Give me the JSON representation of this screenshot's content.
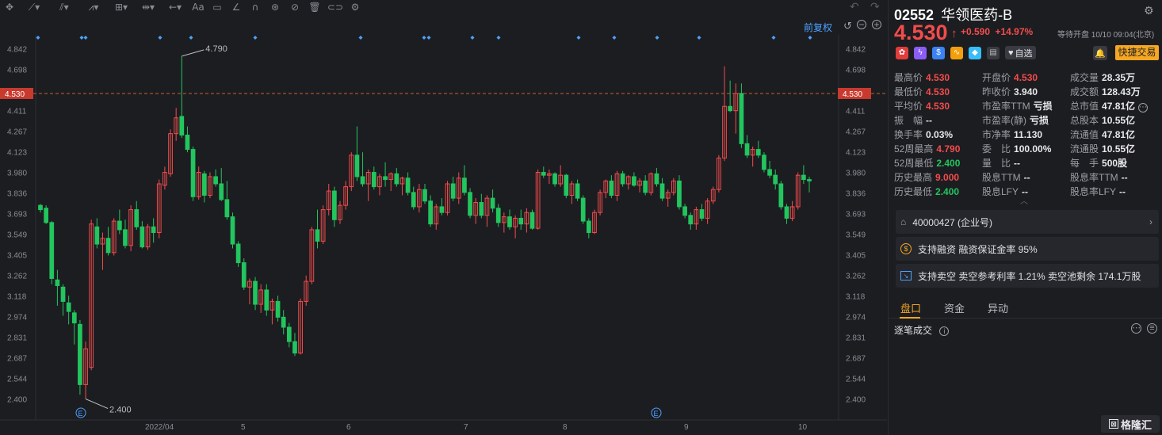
{
  "toolbar": {
    "icons": [
      "move-icon",
      "line-tool-icon",
      "channel-tool-icon",
      "pattern-tool-icon",
      "measure-tool-icon",
      "range-tool-icon",
      "arrow-tool-icon",
      "text-tool-icon",
      "comment-icon",
      "pen-icon",
      "magnet-icon",
      "visibility-icon",
      "hide-icon",
      "trash-icon",
      "link-icon",
      "settings-icon"
    ],
    "undo": "↶",
    "redo": "↷",
    "adjust_label": "前复权"
  },
  "price_axis": [
    "4.842",
    "4.698",
    "4.530",
    "4.411",
    "4.267",
    "4.123",
    "3.980",
    "3.836",
    "3.693",
    "3.549",
    "3.405",
    "3.262",
    "3.118",
    "2.974",
    "2.831",
    "2.687",
    "2.544",
    "2.400"
  ],
  "time_axis": [
    "2022/04",
    "5",
    "6",
    "7",
    "8",
    "9",
    "10"
  ],
  "chart_data": {
    "type": "candlestick",
    "ylim": [
      2.33,
      4.93
    ],
    "current_price": 4.53,
    "high_mark": "4.790",
    "low_mark": "2.400",
    "event_markers": [
      "E",
      "E"
    ],
    "x_ticks": [
      "2022/04",
      "5",
      "6",
      "7",
      "8",
      "9",
      "10"
    ],
    "series_note": "daily OHLC",
    "candles": [
      [
        3.75,
        3.76,
        3.7,
        3.72
      ],
      [
        3.73,
        3.75,
        3.62,
        3.63
      ],
      [
        3.63,
        3.64,
        3.2,
        3.24
      ],
      [
        3.23,
        3.3,
        3.05,
        3.19
      ],
      [
        3.18,
        3.2,
        2.98,
        3.08
      ],
      [
        3.07,
        3.12,
        2.92,
        3.01
      ],
      [
        3.0,
        3.02,
        2.78,
        2.93
      ],
      [
        2.92,
        2.95,
        2.43,
        2.5
      ],
      [
        2.5,
        2.8,
        2.4,
        2.75
      ],
      [
        2.62,
        3.65,
        2.6,
        3.62
      ],
      [
        3.6,
        3.66,
        3.45,
        3.48
      ],
      [
        3.48,
        3.56,
        3.3,
        3.52
      ],
      [
        3.52,
        3.6,
        3.4,
        3.42
      ],
      [
        3.42,
        3.66,
        3.4,
        3.64
      ],
      [
        3.64,
        3.72,
        3.55,
        3.58
      ],
      [
        3.58,
        3.65,
        3.45,
        3.47
      ],
      [
        3.47,
        3.75,
        3.43,
        3.72
      ],
      [
        3.72,
        3.78,
        3.58,
        3.6
      ],
      [
        3.6,
        3.64,
        3.45,
        3.46
      ],
      [
        3.46,
        3.62,
        3.44,
        3.6
      ],
      [
        3.6,
        3.66,
        3.49,
        3.56
      ],
      [
        3.56,
        3.93,
        3.52,
        3.9
      ],
      [
        3.89,
        4.02,
        3.86,
        3.98
      ],
      [
        3.97,
        4.28,
        3.95,
        4.25
      ],
      [
        4.25,
        4.43,
        4.2,
        4.36
      ],
      [
        4.37,
        4.79,
        4.22,
        4.24
      ],
      [
        4.24,
        4.3,
        4.12,
        4.14
      ],
      [
        4.14,
        4.16,
        3.78,
        3.81
      ],
      [
        3.81,
        4.02,
        3.79,
        3.98
      ],
      [
        3.97,
        3.99,
        3.77,
        3.82
      ],
      [
        3.82,
        3.98,
        3.8,
        3.95
      ],
      [
        3.95,
        4.0,
        3.88,
        3.9
      ],
      [
        3.9,
        4.01,
        3.78,
        3.79
      ],
      [
        3.79,
        3.92,
        3.65,
        3.67
      ],
      [
        3.67,
        3.7,
        3.45,
        3.48
      ],
      [
        3.48,
        3.5,
        3.32,
        3.35
      ],
      [
        3.35,
        3.38,
        3.16,
        3.18
      ],
      [
        3.18,
        3.24,
        3.06,
        3.22
      ],
      [
        3.22,
        3.25,
        3.02,
        3.06
      ],
      [
        3.06,
        3.2,
        3.0,
        3.16
      ],
      [
        3.16,
        3.2,
        2.98,
        3.02
      ],
      [
        3.02,
        3.1,
        2.92,
        3.08
      ],
      [
        3.08,
        3.12,
        2.94,
        2.97
      ],
      [
        2.97,
        3.02,
        2.85,
        2.9
      ],
      [
        2.9,
        2.93,
        2.76,
        2.8
      ],
      [
        2.8,
        2.86,
        2.7,
        2.72
      ],
      [
        2.72,
        3.1,
        2.71,
        3.08
      ],
      [
        3.08,
        3.26,
        3.05,
        3.22
      ],
      [
        3.22,
        3.6,
        3.2,
        3.58
      ],
      [
        3.58,
        3.72,
        3.45,
        3.5
      ],
      [
        3.5,
        3.75,
        3.48,
        3.72
      ],
      [
        3.72,
        3.9,
        3.68,
        3.85
      ],
      [
        3.85,
        3.88,
        3.6,
        3.65
      ],
      [
        3.65,
        3.78,
        3.62,
        3.75
      ],
      [
        3.75,
        3.92,
        3.72,
        3.88
      ],
      [
        3.88,
        4.12,
        3.85,
        4.1
      ],
      [
        4.1,
        4.3,
        3.92,
        3.95
      ],
      [
        3.95,
        4.12,
        3.88,
        3.9
      ],
      [
        3.9,
        4.0,
        3.78,
        3.98
      ],
      [
        3.98,
        4.02,
        3.86,
        3.88
      ],
      [
        3.88,
        3.97,
        3.82,
        3.95
      ],
      [
        3.95,
        4.05,
        3.88,
        3.93
      ],
      [
        3.93,
        3.98,
        3.85,
        3.97
      ],
      [
        3.97,
        4.01,
        3.88,
        3.9
      ],
      [
        3.9,
        3.95,
        3.82,
        3.94
      ],
      [
        3.94,
        3.98,
        3.82,
        3.84
      ],
      [
        3.84,
        3.88,
        3.72,
        3.74
      ],
      [
        3.74,
        3.9,
        3.7,
        3.86
      ],
      [
        3.86,
        3.9,
        3.76,
        3.78
      ],
      [
        3.78,
        3.82,
        3.6,
        3.62
      ],
      [
        3.62,
        3.76,
        3.58,
        3.74
      ],
      [
        3.74,
        3.8,
        3.68,
        3.7
      ],
      [
        3.7,
        3.92,
        3.68,
        3.9
      ],
      [
        3.9,
        3.95,
        3.78,
        3.8
      ],
      [
        3.8,
        3.98,
        3.76,
        3.94
      ],
      [
        3.94,
        4.03,
        3.82,
        3.84
      ],
      [
        3.84,
        3.87,
        3.66,
        3.68
      ],
      [
        3.68,
        3.8,
        3.62,
        3.77
      ],
      [
        3.77,
        3.83,
        3.66,
        3.68
      ],
      [
        3.68,
        3.82,
        3.6,
        3.8
      ],
      [
        3.8,
        3.86,
        3.7,
        3.73
      ],
      [
        3.73,
        3.76,
        3.6,
        3.63
      ],
      [
        3.63,
        3.7,
        3.56,
        3.67
      ],
      [
        3.67,
        3.72,
        3.58,
        3.6
      ],
      [
        3.6,
        3.68,
        3.52,
        3.66
      ],
      [
        3.66,
        3.72,
        3.58,
        3.62
      ],
      [
        3.62,
        3.73,
        3.56,
        3.7
      ],
      [
        3.7,
        3.72,
        3.58,
        3.59
      ],
      [
        3.59,
        4.0,
        3.58,
        3.98
      ],
      [
        3.98,
        4.02,
        3.94,
        3.96
      ],
      [
        3.96,
        4.0,
        3.9,
        3.97
      ],
      [
        3.97,
        3.98,
        3.88,
        3.9
      ],
      [
        3.9,
        4.03,
        3.88,
        3.96
      ],
      [
        3.96,
        3.97,
        3.8,
        3.82
      ],
      [
        3.82,
        3.92,
        3.76,
        3.9
      ],
      [
        3.9,
        3.93,
        3.78,
        3.8
      ],
      [
        3.8,
        3.82,
        3.62,
        3.64
      ],
      [
        3.64,
        3.66,
        3.52,
        3.56
      ],
      [
        3.56,
        3.72,
        3.55,
        3.7
      ],
      [
        3.7,
        3.86,
        3.68,
        3.84
      ],
      [
        3.84,
        3.93,
        3.8,
        3.92
      ],
      [
        3.92,
        3.96,
        3.8,
        3.82
      ],
      [
        3.82,
        3.99,
        3.78,
        3.97
      ],
      [
        3.97,
        3.99,
        3.88,
        3.9
      ],
      [
        3.9,
        3.96,
        3.86,
        3.95
      ],
      [
        3.95,
        3.98,
        3.88,
        3.89
      ],
      [
        3.89,
        3.94,
        3.84,
        3.92
      ],
      [
        3.92,
        3.96,
        3.82,
        3.84
      ],
      [
        3.84,
        3.98,
        3.82,
        3.97
      ],
      [
        3.97,
        4.01,
        3.88,
        3.9
      ],
      [
        3.9,
        3.94,
        3.78,
        3.8
      ],
      [
        3.8,
        3.86,
        3.74,
        3.84
      ],
      [
        3.84,
        3.94,
        3.82,
        3.92
      ],
      [
        3.92,
        3.96,
        3.72,
        3.74
      ],
      [
        3.74,
        3.76,
        3.66,
        3.68
      ],
      [
        3.68,
        3.7,
        3.58,
        3.62
      ],
      [
        3.62,
        3.74,
        3.58,
        3.72
      ],
      [
        3.72,
        3.76,
        3.64,
        3.66
      ],
      [
        3.66,
        3.8,
        3.62,
        3.78
      ],
      [
        3.78,
        3.88,
        3.76,
        3.86
      ],
      [
        3.86,
        4.1,
        3.84,
        4.08
      ],
      [
        4.08,
        4.72,
        4.06,
        4.44
      ],
      [
        4.44,
        4.62,
        4.4,
        4.41
      ],
      [
        4.41,
        4.6,
        4.25,
        4.53
      ],
      [
        4.53,
        4.6,
        4.15,
        4.18
      ],
      [
        4.18,
        4.24,
        4.08,
        4.1
      ],
      [
        4.1,
        4.16,
        4.02,
        4.14
      ],
      [
        4.14,
        4.2,
        4.08,
        4.1
      ],
      [
        4.1,
        4.12,
        3.98,
        4.0
      ],
      [
        4.0,
        4.06,
        3.94,
        3.96
      ],
      [
        3.96,
        4.0,
        3.86,
        3.9
      ],
      [
        3.9,
        3.92,
        3.72,
        3.74
      ],
      [
        3.74,
        3.76,
        3.62,
        3.66
      ],
      [
        3.66,
        3.78,
        3.64,
        3.74
      ],
      [
        3.74,
        3.98,
        3.72,
        3.96
      ],
      [
        3.96,
        4.03,
        3.9,
        3.93
      ],
      [
        3.93,
        3.95,
        3.84,
        3.92
      ]
    ]
  },
  "quote": {
    "code": "02552",
    "name": "华领医药-B",
    "price": "4.530",
    "arrow": "↑",
    "change": "+0.590",
    "change_pct": "+14.97%",
    "status": "等待开盘 10/10 09:04(北京)",
    "watch_label": "自选",
    "trade_label": "快捷交易",
    "stats": [
      [
        {
          "k": "最高价",
          "v": "4.530",
          "c": "red"
        },
        {
          "k": "开盘价",
          "v": "4.530",
          "c": "red"
        },
        {
          "k": "成交量",
          "v": "28.35万",
          "c": "wht"
        }
      ],
      [
        {
          "k": "最低价",
          "v": "4.530",
          "c": "red"
        },
        {
          "k": "昨收价",
          "v": "3.940",
          "c": "wht"
        },
        {
          "k": "成交额",
          "v": "128.43万",
          "c": "wht"
        }
      ],
      [
        {
          "k": "平均价",
          "v": "4.530",
          "c": "red"
        },
        {
          "k": "市盈率TTM",
          "v": "亏损",
          "c": "wht"
        },
        {
          "k": "总市值",
          "v": "47.81亿",
          "c": "wht"
        }
      ],
      [
        {
          "k": "振　幅",
          "v": "--",
          "c": "wht"
        },
        {
          "k": "市盈率(静)",
          "v": "亏损",
          "c": "wht"
        },
        {
          "k": "总股本",
          "v": "10.55亿",
          "c": "wht"
        }
      ],
      [
        {
          "k": "换手率",
          "v": "0.03%",
          "c": "wht"
        },
        {
          "k": "市净率",
          "v": "11.130",
          "c": "wht"
        },
        {
          "k": "流通值",
          "v": "47.81亿",
          "c": "wht"
        }
      ],
      [
        {
          "k": "52周最高",
          "v": "4.790",
          "c": "red"
        },
        {
          "k": "委　比",
          "v": "100.00%",
          "c": "wht"
        },
        {
          "k": "流通股",
          "v": "10.55亿",
          "c": "wht"
        }
      ],
      [
        {
          "k": "52周最低",
          "v": "2.400",
          "c": "grn"
        },
        {
          "k": "量　比",
          "v": "--",
          "c": "wht"
        },
        {
          "k": "每　手",
          "v": "500股",
          "c": "wht"
        }
      ],
      [
        {
          "k": "历史最高",
          "v": "9.000",
          "c": "red"
        },
        {
          "k": "股息TTM",
          "v": "--",
          "c": "wht"
        },
        {
          "k": "股息率TTM",
          "v": "--",
          "c": "wht"
        }
      ],
      [
        {
          "k": "历史最低",
          "v": "2.400",
          "c": "grn"
        },
        {
          "k": "股息LFY",
          "v": "--",
          "c": "wht"
        },
        {
          "k": "股息率LFY",
          "v": "--",
          "c": "wht"
        }
      ]
    ]
  },
  "cards": {
    "enterprise": "40000427 (企业号)",
    "margin": "支持融资 融资保证金率 95%",
    "short": "支持卖空 卖空参考利率 1.21% 卖空池剩余 174.1万股"
  },
  "tabs": [
    "盘口",
    "资金",
    "异动"
  ],
  "ticks_section": {
    "title": "逐笔成交"
  },
  "logo": "格隆汇",
  "colors": {
    "up": "#f24c4c",
    "down": "#22c55e",
    "accent": "#f5a623",
    "bg": "#1c1d21"
  }
}
